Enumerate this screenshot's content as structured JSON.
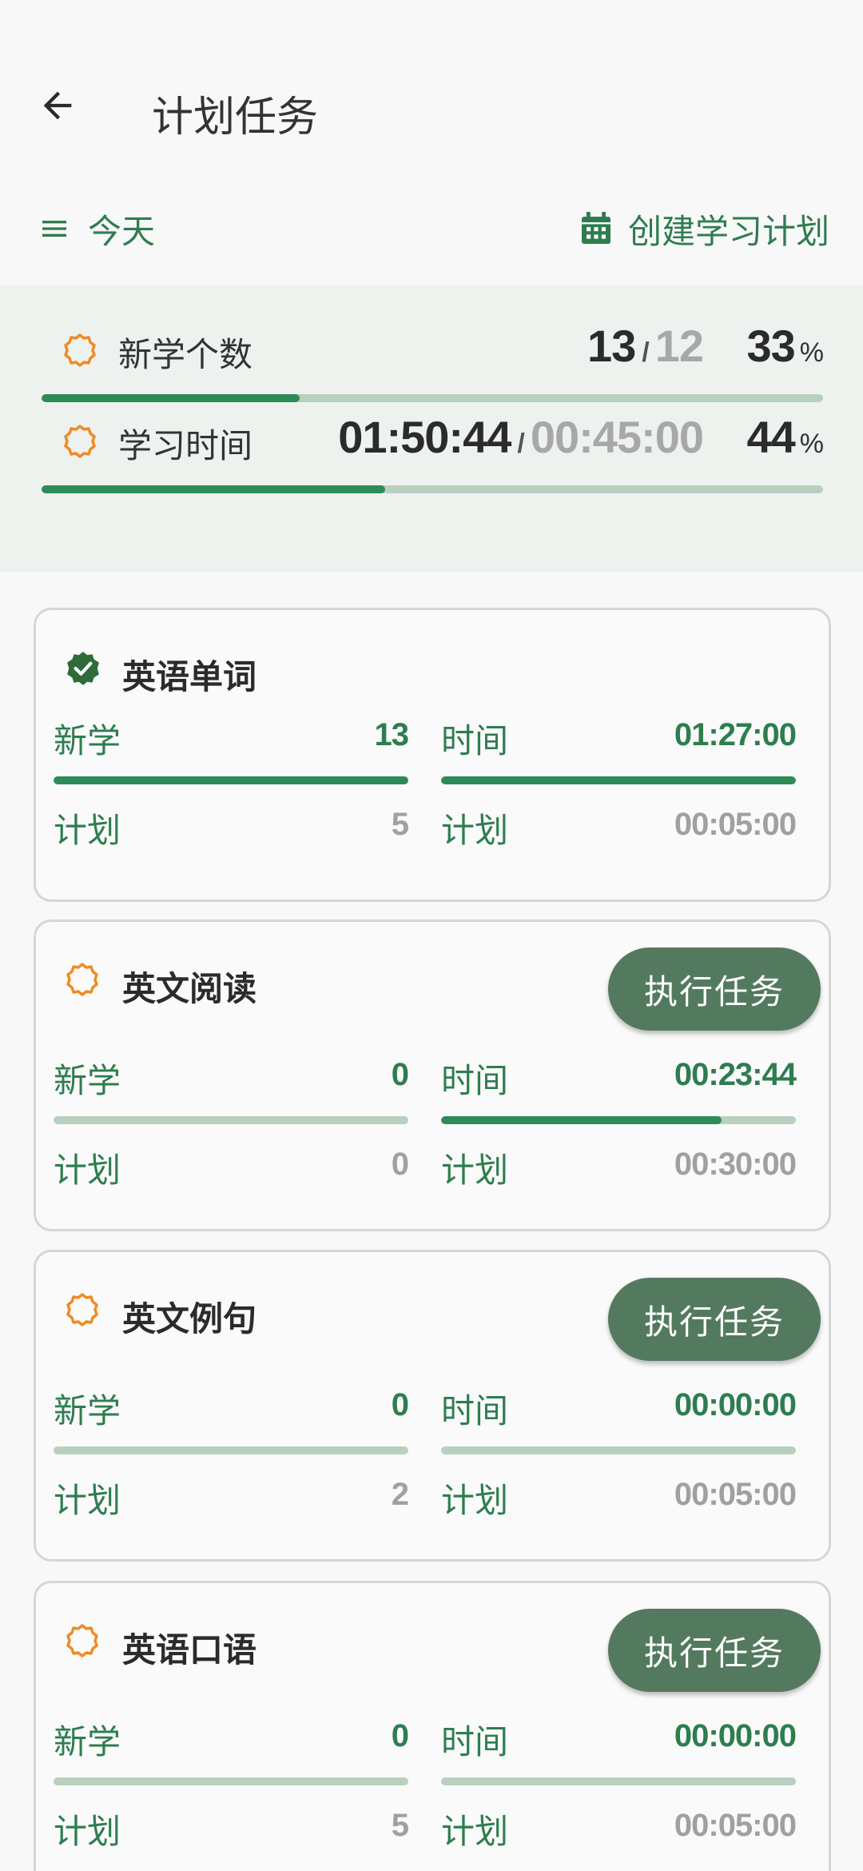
{
  "header": {
    "title": "计划任务",
    "back_icon": "arrow-left-icon"
  },
  "toolbar": {
    "day_label": "今天",
    "day_icon": "menu-icon",
    "create_label": "创建学习计划",
    "create_icon": "calendar-icon"
  },
  "summary": {
    "new_items": {
      "label": "新学个数",
      "done": "13",
      "target": "12",
      "percent": "33",
      "percent_sign": "%",
      "progress": 0.33
    },
    "study_time": {
      "label": "学习时间",
      "done": "01:50:44",
      "target": "00:45:00",
      "percent": "44",
      "percent_sign": "%",
      "progress": 0.44
    },
    "slash": "/"
  },
  "tasks": [
    {
      "name": "英语单词",
      "status": "completed",
      "new_label": "新学",
      "new_value": "13",
      "new_progress": 1.0,
      "new_plan_label": "计划",
      "new_plan_value": "5",
      "time_label": "时间",
      "time_value": "01:27:00",
      "time_progress": 1.0,
      "time_plan_label": "计划",
      "time_plan_value": "00:05:00"
    },
    {
      "name": "英文阅读",
      "status": "pending",
      "action_label": "执行任务",
      "new_label": "新学",
      "new_value": "0",
      "new_progress": 0,
      "new_plan_label": "计划",
      "new_plan_value": "0",
      "time_label": "时间",
      "time_value": "00:23:44",
      "time_progress": 0.79,
      "time_plan_label": "计划",
      "time_plan_value": "00:30:00"
    },
    {
      "name": "英文例句",
      "status": "pending",
      "action_label": "执行任务",
      "new_label": "新学",
      "new_value": "0",
      "new_progress": 0,
      "new_plan_label": "计划",
      "new_plan_value": "2",
      "time_label": "时间",
      "time_value": "00:00:00",
      "time_progress": 0,
      "time_plan_label": "计划",
      "time_plan_value": "00:05:00"
    },
    {
      "name": "英语口语",
      "status": "pending",
      "action_label": "执行任务",
      "new_label": "新学",
      "new_value": "0",
      "new_progress": 0,
      "new_plan_label": "计划",
      "new_plan_value": "5",
      "time_label": "时间",
      "time_value": "00:00:00",
      "time_progress": 0,
      "time_plan_label": "计划",
      "time_plan_value": "00:05:00"
    }
  ],
  "colors": {
    "accent": "#2e7d4f",
    "bar_fill": "#2e8b57",
    "bar_track": "#b9d0bf",
    "button": "#537a5f",
    "pending_ring": "#f08a24"
  }
}
